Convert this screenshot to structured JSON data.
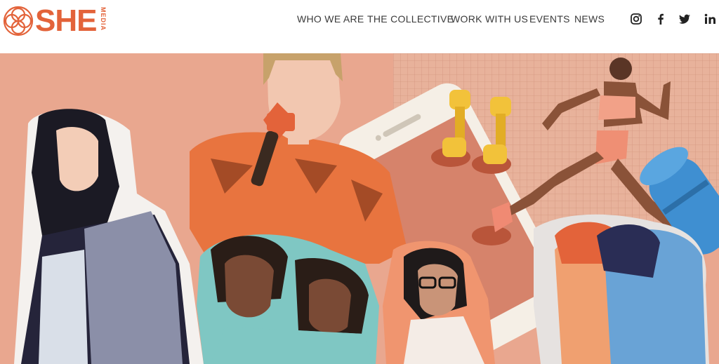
{
  "brand": {
    "name": "SHE",
    "sub": "MEDIA",
    "color": "#e3633a"
  },
  "nav": {
    "items": [
      {
        "label": "WHO WE ARE"
      },
      {
        "label": "THE COLLECTIVE"
      },
      {
        "label": "WORK WITH US"
      },
      {
        "label": "EVENTS"
      },
      {
        "label": "NEWS"
      }
    ]
  },
  "social": {
    "icons": [
      "instagram-icon",
      "facebook-icon",
      "twitter-icon",
      "linkedin-icon"
    ],
    "linkedin_label": "in",
    "facebook_label": "f"
  },
  "hero": {
    "background": "#e9a78f",
    "grid_color": "#c98a73",
    "phone_color": "#f5efe6",
    "accent": "#e3633a",
    "dumbbell_color": "#f2c23a",
    "yoga_mat_color": "#3f8fd1"
  }
}
